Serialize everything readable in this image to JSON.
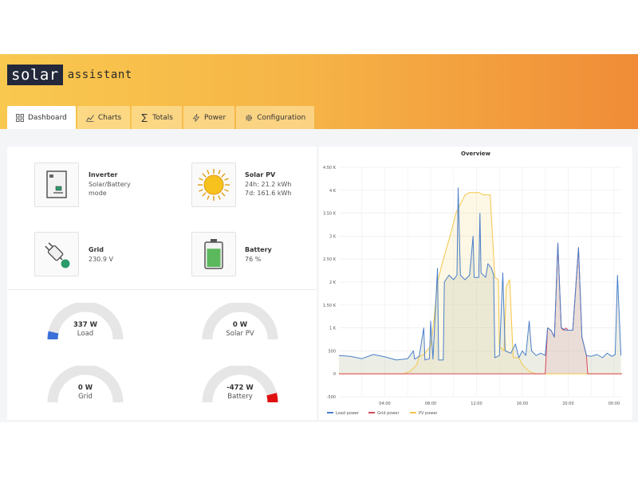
{
  "app": {
    "logo_box": "solar",
    "logo_text": "assistant"
  },
  "tabs": [
    {
      "label": "Dashboard",
      "icon": "grid-icon",
      "active": true
    },
    {
      "label": "Charts",
      "icon": "bar-chart-icon",
      "active": false
    },
    {
      "label": "Totals",
      "icon": "sigma-icon",
      "active": false
    },
    {
      "label": "Power",
      "icon": "lightning-icon",
      "active": false
    },
    {
      "label": "Configuration",
      "icon": "gear-icon",
      "active": false
    }
  ],
  "cards": {
    "inverter": {
      "title": "Inverter",
      "line1": "Solar/Battery",
      "line2": "mode"
    },
    "solar_pv": {
      "title": "Solar PV",
      "line1": "24h: 21.2 kWh",
      "line2": "7d: 161.6 kWh"
    },
    "grid": {
      "title": "Grid",
      "line1": "230.9 V"
    },
    "battery": {
      "title": "Battery",
      "line1": "76 %",
      "level": 0.76
    }
  },
  "gauges": {
    "load": {
      "value": "337 W",
      "label": "Load",
      "fill": 0.07,
      "color": "#3b6fd8"
    },
    "solar_pv": {
      "value": "0 W",
      "label": "Solar PV",
      "fill": 0,
      "color": "#f2c230"
    },
    "grid": {
      "value": "0 W",
      "label": "Grid",
      "fill": 0,
      "color": "#d93b46"
    },
    "battery": {
      "value": "-472 W",
      "label": "Battery",
      "fill": -0.08,
      "color": "#e01010"
    }
  },
  "colors": {
    "load": "#4a7fcb",
    "grid": "#d84a5e",
    "pv": "#f3c648",
    "gauge_bg": "#e6e6e6"
  },
  "chart_data": {
    "type": "line",
    "title": "Overview",
    "y_ticks": [
      "4.50 K",
      "4 K",
      "3.50 K",
      "3 K",
      "2.50 K",
      "2 K",
      "1.50 K",
      "1 K",
      "500",
      "0",
      "-500"
    ],
    "y_tick_values": [
      4500,
      4000,
      3500,
      3000,
      2500,
      2000,
      1500,
      1000,
      500,
      0,
      -500
    ],
    "ylim": [
      -500,
      4500
    ],
    "x_ticks": [
      "04:00",
      "08:00",
      "12:00",
      "16:00",
      "20:00",
      "00:00"
    ],
    "x_tick_hours": [
      4,
      8,
      12,
      16,
      20,
      24
    ],
    "xlim": [
      0,
      24.7
    ],
    "legend": [
      "Load power",
      "Grid power",
      "PV power"
    ],
    "legend_position": "bottom-left",
    "grid": true,
    "series": [
      {
        "name": "Load power",
        "points": [
          [
            0,
            400
          ],
          [
            1,
            380
          ],
          [
            2,
            330
          ],
          [
            3,
            420
          ],
          [
            4,
            370
          ],
          [
            5,
            300
          ],
          [
            6,
            330
          ],
          [
            6.5,
            500
          ],
          [
            6.6,
            320
          ],
          [
            7,
            380
          ],
          [
            7.4,
            1000
          ],
          [
            7.5,
            300
          ],
          [
            7.9,
            330
          ],
          [
            8,
            1150
          ],
          [
            8.2,
            320
          ],
          [
            8.6,
            2300
          ],
          [
            8.7,
            300
          ],
          [
            9.1,
            300
          ],
          [
            9.2,
            2000
          ],
          [
            9.6,
            2150
          ],
          [
            10,
            2050
          ],
          [
            10.3,
            2150
          ],
          [
            10.4,
            4050
          ],
          [
            10.6,
            2150
          ],
          [
            11,
            2050
          ],
          [
            11.4,
            2150
          ],
          [
            11.7,
            3000
          ],
          [
            11.8,
            2100
          ],
          [
            12.2,
            2100
          ],
          [
            12.3,
            3500
          ],
          [
            12.4,
            2200
          ],
          [
            12.8,
            2100
          ],
          [
            13,
            2400
          ],
          [
            13.3,
            2300
          ],
          [
            13.5,
            2150
          ],
          [
            13.6,
            350
          ],
          [
            14,
            400
          ],
          [
            14.3,
            2200
          ],
          [
            14.5,
            500
          ],
          [
            15,
            450
          ],
          [
            15.4,
            650
          ],
          [
            15.7,
            350
          ],
          [
            16,
            500
          ],
          [
            16.3,
            400
          ],
          [
            16.6,
            1150
          ],
          [
            16.8,
            500
          ],
          [
            17.2,
            400
          ],
          [
            17.6,
            450
          ],
          [
            18,
            400
          ],
          [
            18.2,
            1000
          ],
          [
            18.5,
            950
          ],
          [
            18.8,
            800
          ],
          [
            19.1,
            2850
          ],
          [
            19.4,
            1000
          ],
          [
            19.8,
            950
          ],
          [
            20,
            950
          ],
          [
            20.4,
            950
          ],
          [
            20.9,
            2750
          ],
          [
            21.2,
            800
          ],
          [
            21.6,
            400
          ],
          [
            22,
            380
          ],
          [
            22.5,
            420
          ],
          [
            23,
            350
          ],
          [
            23.4,
            450
          ],
          [
            23.8,
            380
          ],
          [
            24.1,
            420
          ],
          [
            24.3,
            2150
          ],
          [
            24.6,
            400
          ]
        ]
      },
      {
        "name": "Grid power",
        "points": [
          [
            0,
            0
          ],
          [
            17.6,
            0
          ],
          [
            18,
            0
          ],
          [
            18.2,
            1000
          ],
          [
            18.5,
            950
          ],
          [
            18.8,
            800
          ],
          [
            19.1,
            2850
          ],
          [
            19.4,
            1000
          ],
          [
            19.6,
            950
          ],
          [
            19.8,
            1000
          ],
          [
            20,
            950
          ],
          [
            20.4,
            950
          ],
          [
            20.9,
            2750
          ],
          [
            21.2,
            800
          ],
          [
            21.6,
            400
          ],
          [
            21.7,
            0
          ],
          [
            24.7,
            0
          ]
        ]
      },
      {
        "name": "PV power",
        "points": [
          [
            0,
            0
          ],
          [
            5.6,
            0
          ],
          [
            6.2,
            50
          ],
          [
            6.8,
            200
          ],
          [
            7,
            380
          ],
          [
            7.4,
            420
          ],
          [
            8,
            600
          ],
          [
            8.3,
            1200
          ],
          [
            8.6,
            2000
          ],
          [
            9,
            2400
          ],
          [
            9.4,
            2750
          ],
          [
            9.8,
            3100
          ],
          [
            10.2,
            3500
          ],
          [
            10.5,
            3650
          ],
          [
            10.8,
            3800
          ],
          [
            11,
            3900
          ],
          [
            11.4,
            3950
          ],
          [
            11.8,
            3950
          ],
          [
            12.2,
            3950
          ],
          [
            12.6,
            3900
          ],
          [
            13.2,
            3900
          ],
          [
            13.4,
            3000
          ],
          [
            13.6,
            2100
          ],
          [
            13.9,
            2050
          ],
          [
            14,
            600
          ],
          [
            14.4,
            500
          ],
          [
            14.6,
            1900
          ],
          [
            14.9,
            2050
          ],
          [
            15.2,
            350
          ],
          [
            15.7,
            350
          ],
          [
            16,
            200
          ],
          [
            16.6,
            50
          ],
          [
            17.2,
            0
          ],
          [
            24.7,
            0
          ]
        ]
      }
    ]
  }
}
